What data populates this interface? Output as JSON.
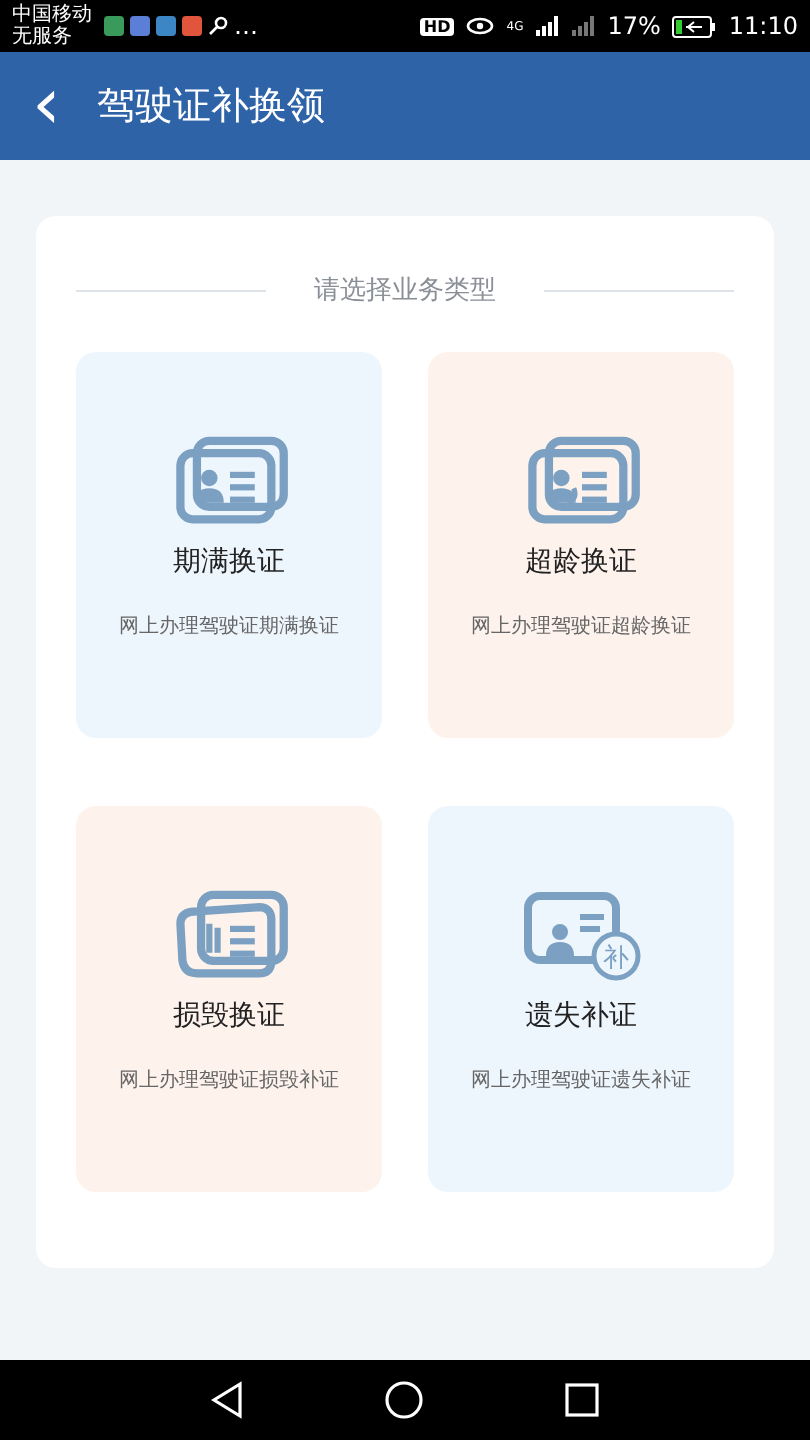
{
  "status_bar": {
    "carrier": "中国移动",
    "service": "无服务",
    "more": "…",
    "hd": "HD",
    "network": "4G",
    "battery": "17%",
    "time": "11:10"
  },
  "header": {
    "back": "‹",
    "title": "驾驶证补换领"
  },
  "section_title": "请选择业务类型",
  "tiles": [
    {
      "kind": "expiry",
      "title": "期满换证",
      "subtitle": "网上办理驾驶证期满换证",
      "color": "#eef6fd"
    },
    {
      "kind": "age",
      "title": "超龄换证",
      "subtitle": "网上办理驾驶证超龄换证",
      "color": "#fdf3ec"
    },
    {
      "kind": "damaged",
      "title": "损毁换证",
      "subtitle": "网上办理驾驶证损毁补证",
      "color": "#fdf3ec"
    },
    {
      "kind": "lost",
      "title": "遗失补证",
      "subtitle": "网上办理驾驶证遗失补证",
      "color": "#eef6fd"
    }
  ],
  "lost_icon_badge": "补"
}
